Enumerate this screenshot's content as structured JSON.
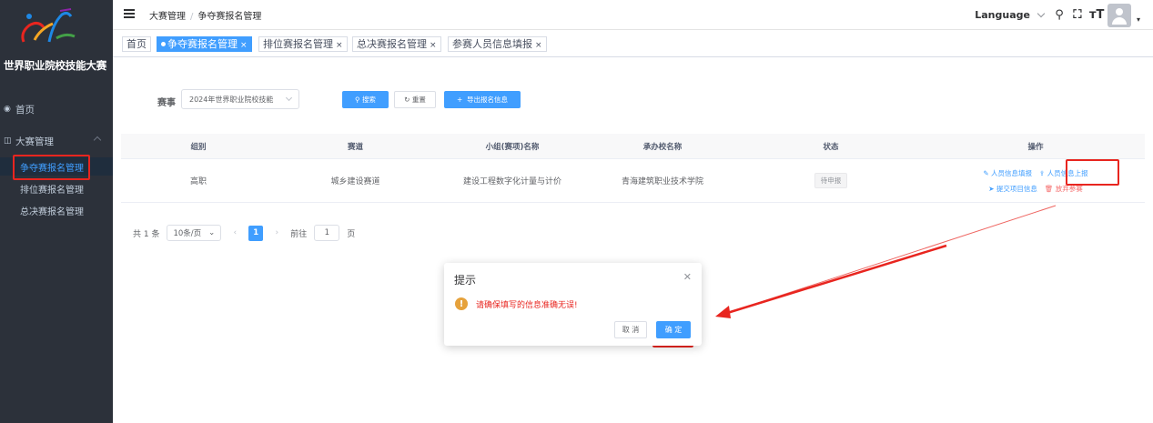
{
  "sidebar": {
    "brand": "世界职业院校技能大赛",
    "home": {
      "icon": "dashboard-icon",
      "label": "首页"
    },
    "group": {
      "icon": "book-icon",
      "label": "大赛管理"
    },
    "sub_items": [
      "争夺赛报名管理",
      "排位赛报名管理",
      "总决赛报名管理"
    ]
  },
  "navbar": {
    "breadcrumb": [
      "大赛管理",
      "争夺赛报名管理"
    ],
    "language": "Language",
    "icons": [
      "search-icon",
      "fullscreen-icon",
      "font-size-icon",
      "avatar"
    ]
  },
  "tags": [
    {
      "label": "首页",
      "active": false,
      "closable": false
    },
    {
      "label": "争夺赛报名管理",
      "active": true,
      "closable": true
    },
    {
      "label": "排位赛报名管理",
      "active": false,
      "closable": true
    },
    {
      "label": "总决赛报名管理",
      "active": false,
      "closable": true
    },
    {
      "label": "参赛人员信息填报",
      "active": false,
      "closable": true
    }
  ],
  "filter": {
    "label": "赛事",
    "select_value": "2024年世界职业院校技能",
    "search_label": "搜索",
    "reset_label": "重置",
    "export_label": "导出报名信息"
  },
  "table": {
    "columns": [
      "组别",
      "赛道",
      "小组(赛项)名称",
      "承办校名称",
      "状态",
      "操作"
    ],
    "rows": [
      {
        "group": "高职",
        "track": "城乡建设赛道",
        "event": "建设工程数字化计量与计价",
        "school": "青海建筑职业技术学院",
        "status": "待申报",
        "ops": {
          "fill": "人员信息填报",
          "upload": "人员信息上报",
          "submit": "提交项目信息",
          "abandon": "放弃参赛"
        }
      }
    ]
  },
  "pager": {
    "total": "共 1 条",
    "page_size": "10条/页",
    "current_page": "1",
    "goto_label": "前往",
    "goto_value": "1",
    "page_suffix": "页"
  },
  "dialog": {
    "title": "提示",
    "message": "请确保填写的信息准确无误!",
    "cancel_label": "取 消",
    "confirm_label": "确 定"
  },
  "colors": {
    "primary": "#409eff",
    "sidebar_bg": "#2c313a",
    "annotation": "#e8251f",
    "warning": "#e6a23c"
  }
}
